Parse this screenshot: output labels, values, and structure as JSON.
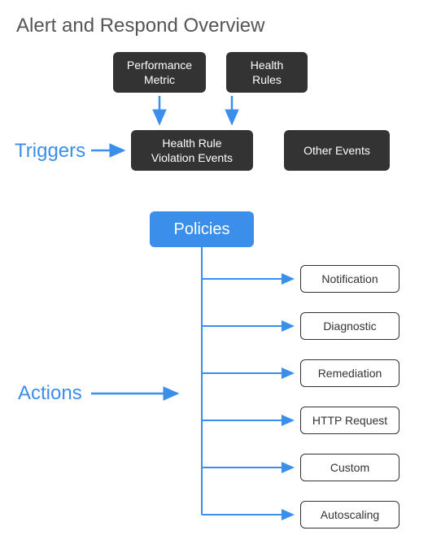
{
  "title": "Alert and Respond Overview",
  "boxes": {
    "perf_metric": "Performance\nMetric",
    "health_rules": "Health\nRules",
    "violation_events": "Health Rule\nViolation Events",
    "other_events": "Other Events",
    "policies": "Policies"
  },
  "labels": {
    "triggers": "Triggers",
    "actions": "Actions"
  },
  "actions": [
    "Notification",
    "Diagnostic",
    "Remediation",
    "HTTP Request",
    "Custom",
    "Autoscaling"
  ],
  "colors": {
    "dark": "#333333",
    "blue": "#3b8eea",
    "text_title": "#555555"
  }
}
